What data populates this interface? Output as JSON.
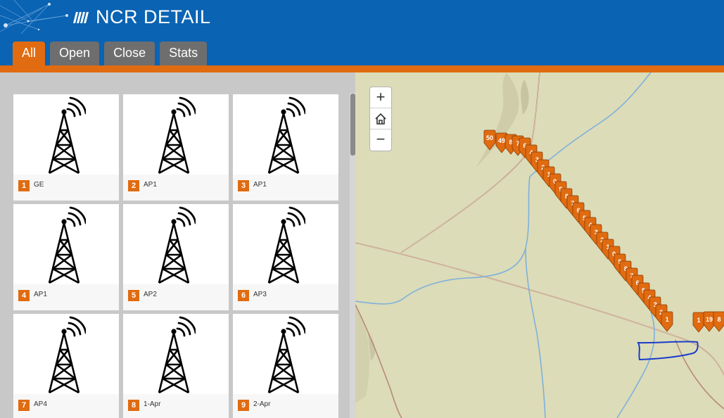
{
  "header": {
    "title": "NCR DETAIL",
    "logo_icon": "slash-bars-icon"
  },
  "tabs": [
    {
      "label": "All",
      "active": true
    },
    {
      "label": "Open",
      "active": false
    },
    {
      "label": "Close",
      "active": false
    },
    {
      "label": "Stats",
      "active": false
    }
  ],
  "gallery": {
    "thumbnail_icon": "radio-tower-icon",
    "cards": [
      {
        "num": "1",
        "label": "GE"
      },
      {
        "num": "2",
        "label": "AP1"
      },
      {
        "num": "3",
        "label": "AP1"
      },
      {
        "num": "4",
        "label": "AP1"
      },
      {
        "num": "5",
        "label": "AP2"
      },
      {
        "num": "6",
        "label": "AP3"
      },
      {
        "num": "7",
        "label": "AP4"
      },
      {
        "num": "8",
        "label": "1-Apr"
      },
      {
        "num": "9",
        "label": "2-Apr"
      }
    ]
  },
  "map": {
    "zoom_in": "+",
    "home_icon": "home-icon",
    "zoom_out": "−",
    "marker_color": "#e06b10",
    "marker_labels": [
      "50",
      "49",
      "8",
      "7",
      "6",
      "4",
      "3",
      "2",
      "1",
      "0",
      "9",
      "8",
      "7",
      "6",
      "5",
      "4",
      "3",
      "2",
      "1",
      "0",
      "9",
      "8",
      "7",
      "6",
      "5",
      "4",
      "3",
      "2",
      "1",
      "1",
      "19",
      "8"
    ]
  },
  "colors": {
    "header_bg": "#0a63b3",
    "accent": "#e06b10",
    "tab_inactive": "#6e6e6e"
  }
}
